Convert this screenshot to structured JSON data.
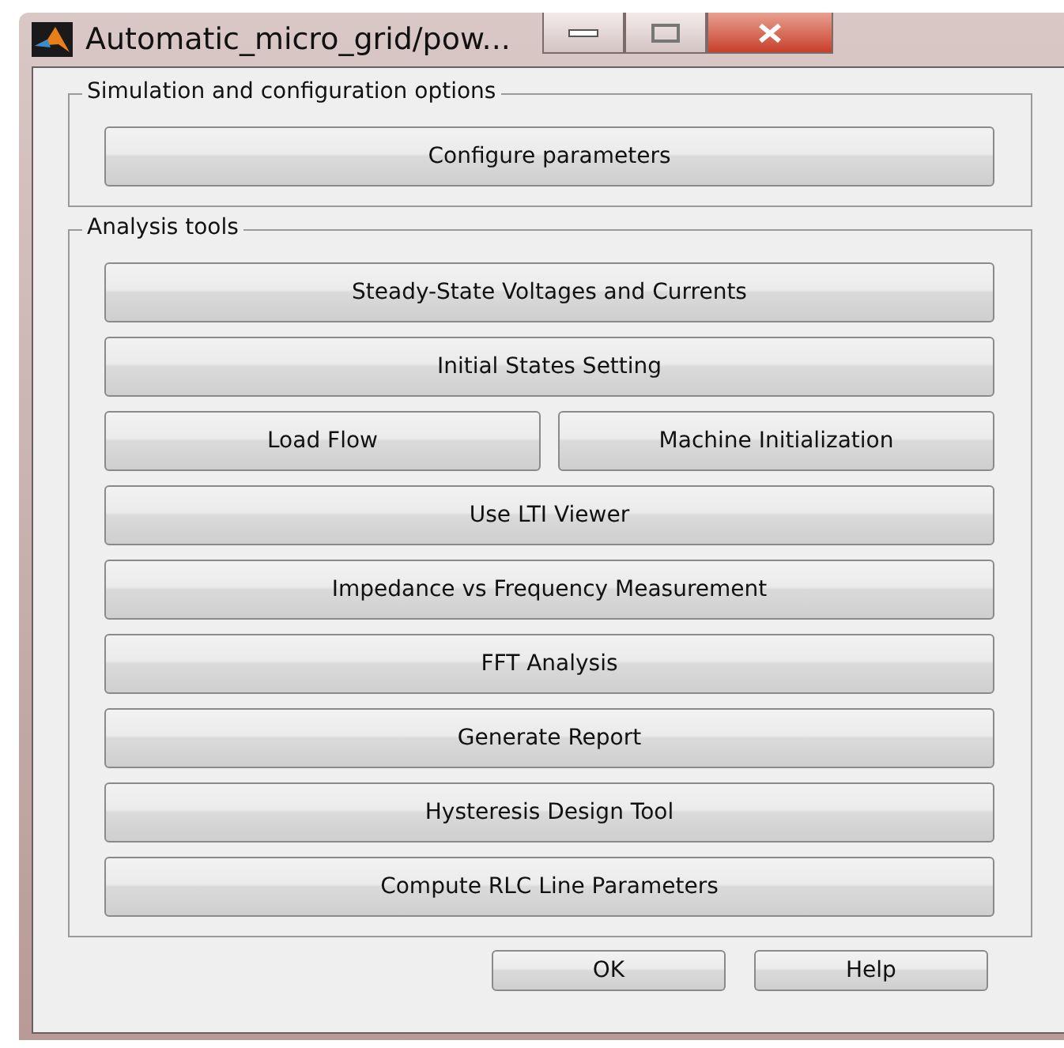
{
  "window": {
    "title": "Automatic_micro_grid/pow..."
  },
  "groups": [
    {
      "title": "Simulation and configuration options",
      "rows": [
        {
          "buttons": [
            "Configure parameters"
          ]
        }
      ]
    },
    {
      "title": "Analysis tools",
      "rows": [
        {
          "buttons": [
            "Steady-State Voltages and Currents"
          ]
        },
        {
          "buttons": [
            "Initial States Setting"
          ]
        },
        {
          "buttons": [
            "Load Flow",
            "Machine Initialization"
          ]
        },
        {
          "buttons": [
            "Use LTI Viewer"
          ]
        },
        {
          "buttons": [
            "Impedance vs Frequency Measurement"
          ]
        },
        {
          "buttons": [
            "FFT Analysis"
          ]
        },
        {
          "buttons": [
            "Generate Report"
          ]
        },
        {
          "buttons": [
            "Hysteresis Design Tool"
          ]
        },
        {
          "buttons": [
            "Compute RLC  Line Parameters"
          ]
        }
      ]
    }
  ],
  "buttons": [
    "OK",
    "Help"
  ]
}
